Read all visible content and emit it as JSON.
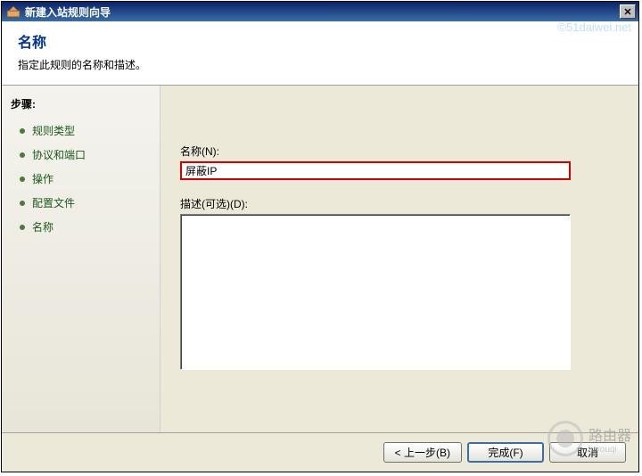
{
  "window": {
    "title": "新建入站规则向导"
  },
  "header": {
    "title": "名称",
    "description": "指定此规则的名称和描述。"
  },
  "sidebar": {
    "label": "步骤:",
    "items": [
      {
        "label": "规则类型"
      },
      {
        "label": "协议和端口"
      },
      {
        "label": "操作"
      },
      {
        "label": "配置文件"
      },
      {
        "label": "名称"
      }
    ]
  },
  "form": {
    "name_label": "名称(N):",
    "name_value": "屏蔽IP",
    "desc_label": "描述(可选)(D):",
    "desc_value": ""
  },
  "footer": {
    "back": "< 上一步(B)",
    "finish": "完成(F)",
    "cancel": "取消"
  },
  "watermarks": {
    "top": "©51daiwei.net",
    "logo_text": "路由器",
    "logo_sub": "luyouqi"
  }
}
